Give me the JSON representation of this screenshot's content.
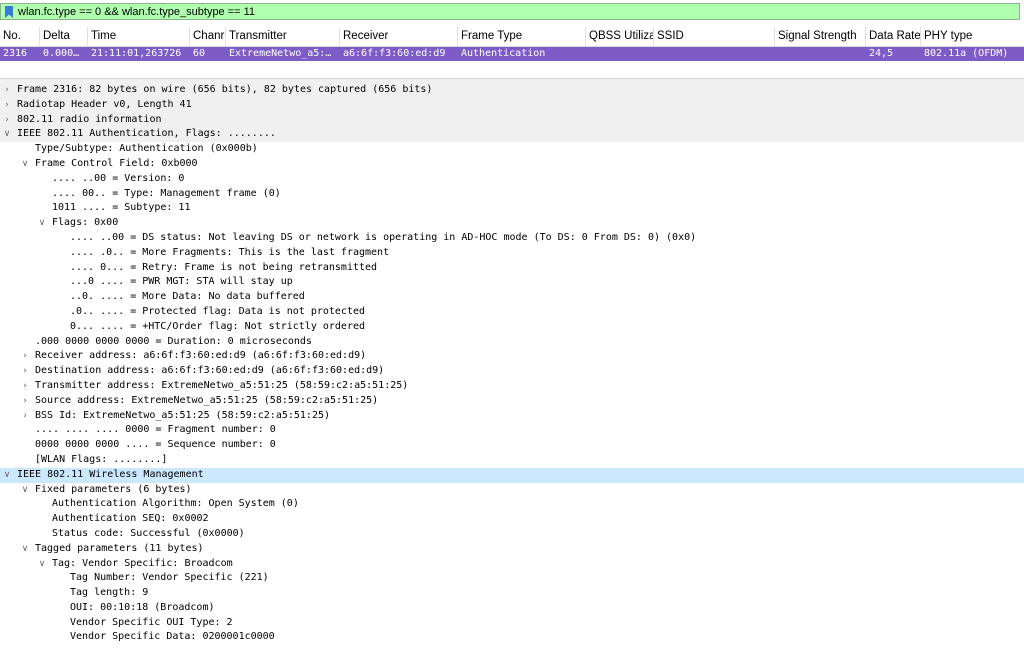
{
  "filter": {
    "expression": "wlan.fc.type == 0 && wlan.fc.type_subtype == 11"
  },
  "columns": [
    "No.",
    "Delta",
    "Time",
    "Chanr",
    "Transmitter",
    "Receiver",
    "Frame Type",
    "QBSS Utiliza",
    "SSID",
    "Signal Strength",
    "Data Rate",
    "PHY type"
  ],
  "packet": {
    "no": "2316",
    "delta": "0.000…",
    "time": "21:11:01,263726",
    "channel": "60",
    "transmitter": "ExtremeNetwo_a5:…",
    "receiver": "a6:6f:f3:60:ed:d9",
    "frame_type": "Authentication",
    "qbss": "",
    "ssid": "",
    "signal": "",
    "data_rate": "24,5",
    "phy": "802.11a (OFDM)"
  },
  "colors": {
    "filter_ok": "#afffaf",
    "selected_row": "#7d5cc8",
    "tree_selected": "#cce8ff"
  },
  "tree": [
    {
      "text": "Frame 2316: 82 bytes on wire (656 bits), 82 bytes captured (656 bits)",
      "level": 0,
      "arrow": "collapsed",
      "style": "section"
    },
    {
      "text": "Radiotap Header v0, Length 41",
      "level": 0,
      "arrow": "collapsed",
      "style": "section"
    },
    {
      "text": "802.11 radio information",
      "level": 0,
      "arrow": "collapsed",
      "style": "section"
    },
    {
      "text": "IEEE 802.11 Authentication, Flags: ........",
      "level": 0,
      "arrow": "expanded",
      "style": "section"
    },
    {
      "text": "Type/Subtype: Authentication (0x000b)",
      "level": 1,
      "arrow": "none"
    },
    {
      "text": "Frame Control Field: 0xb000",
      "level": 1,
      "arrow": "expanded"
    },
    {
      "text": ".... ..00 = Version: 0",
      "level": 2,
      "arrow": "none"
    },
    {
      "text": ".... 00.. = Type: Management frame (0)",
      "level": 2,
      "arrow": "none"
    },
    {
      "text": "1011 .... = Subtype: 11",
      "level": 2,
      "arrow": "none"
    },
    {
      "text": "Flags: 0x00",
      "level": 2,
      "arrow": "expanded"
    },
    {
      "text": ".... ..00 = DS status: Not leaving DS or network is operating in AD-HOC mode (To DS: 0 From DS: 0) (0x0)",
      "level": 3,
      "arrow": "none"
    },
    {
      "text": ".... .0.. = More Fragments: This is the last fragment",
      "level": 3,
      "arrow": "none"
    },
    {
      "text": ".... 0... = Retry: Frame is not being retransmitted",
      "level": 3,
      "arrow": "none"
    },
    {
      "text": "...0 .... = PWR MGT: STA will stay up",
      "level": 3,
      "arrow": "none"
    },
    {
      "text": "..0. .... = More Data: No data buffered",
      "level": 3,
      "arrow": "none"
    },
    {
      "text": ".0.. .... = Protected flag: Data is not protected",
      "level": 3,
      "arrow": "none"
    },
    {
      "text": "0... .... = +HTC/Order flag: Not strictly ordered",
      "level": 3,
      "arrow": "none"
    },
    {
      "text": ".000 0000 0000 0000 = Duration: 0 microseconds",
      "level": 1,
      "arrow": "none"
    },
    {
      "text": "Receiver address: a6:6f:f3:60:ed:d9 (a6:6f:f3:60:ed:d9)",
      "level": 1,
      "arrow": "collapsed"
    },
    {
      "text": "Destination address: a6:6f:f3:60:ed:d9 (a6:6f:f3:60:ed:d9)",
      "level": 1,
      "arrow": "collapsed"
    },
    {
      "text": "Transmitter address: ExtremeNetwo_a5:51:25 (58:59:c2:a5:51:25)",
      "level": 1,
      "arrow": "collapsed"
    },
    {
      "text": "Source address: ExtremeNetwo_a5:51:25 (58:59:c2:a5:51:25)",
      "level": 1,
      "arrow": "collapsed"
    },
    {
      "text": "BSS Id: ExtremeNetwo_a5:51:25 (58:59:c2:a5:51:25)",
      "level": 1,
      "arrow": "collapsed"
    },
    {
      "text": ".... .... .... 0000 = Fragment number: 0",
      "level": 1,
      "arrow": "none"
    },
    {
      "text": "0000 0000 0000 .... = Sequence number: 0",
      "level": 1,
      "arrow": "none"
    },
    {
      "text": "[WLAN Flags: ........]",
      "level": 1,
      "arrow": "none"
    },
    {
      "text": "IEEE 802.11 Wireless Management",
      "level": 0,
      "arrow": "expanded",
      "style": "selected"
    },
    {
      "text": "Fixed parameters (6 bytes)",
      "level": 1,
      "arrow": "expanded"
    },
    {
      "text": "Authentication Algorithm: Open System (0)",
      "level": 2,
      "arrow": "none"
    },
    {
      "text": "Authentication SEQ: 0x0002",
      "level": 2,
      "arrow": "none"
    },
    {
      "text": "Status code: Successful (0x0000)",
      "level": 2,
      "arrow": "none"
    },
    {
      "text": "Tagged parameters (11 bytes)",
      "level": 1,
      "arrow": "expanded"
    },
    {
      "text": "Tag: Vendor Specific: Broadcom",
      "level": 2,
      "arrow": "expanded"
    },
    {
      "text": "Tag Number: Vendor Specific (221)",
      "level": 3,
      "arrow": "none"
    },
    {
      "text": "Tag length: 9",
      "level": 3,
      "arrow": "none"
    },
    {
      "text": "OUI: 00:10:18 (Broadcom)",
      "level": 3,
      "arrow": "none"
    },
    {
      "text": "Vendor Specific OUI Type: 2",
      "level": 3,
      "arrow": "none"
    },
    {
      "text": "Vendor Specific Data: 0200001c0000",
      "level": 3,
      "arrow": "none"
    }
  ]
}
